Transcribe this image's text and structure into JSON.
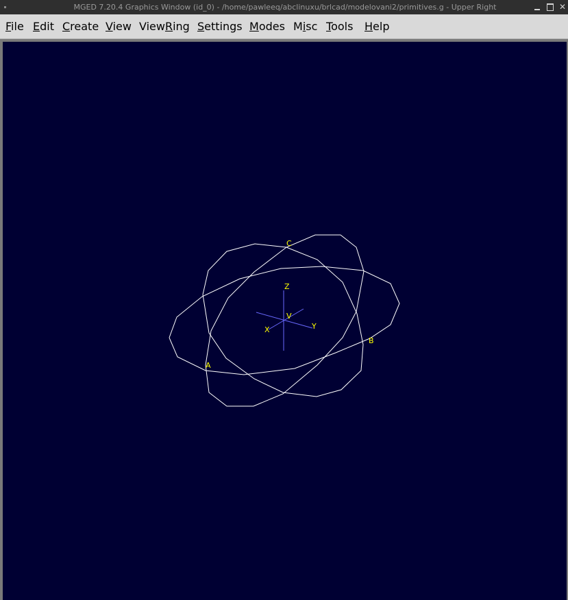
{
  "window": {
    "title": "MGED 7.20.4 Graphics Window (id_0) - /home/pawleeq/abclinuxu/brlcad/modelovani2/primitives.g - Upper Right"
  },
  "menu": {
    "items": [
      {
        "pre": "",
        "u": "F",
        "post": "ile"
      },
      {
        "pre": "",
        "u": "E",
        "post": "dit"
      },
      {
        "pre": "",
        "u": "C",
        "post": "reate"
      },
      {
        "pre": "",
        "u": "V",
        "post": "iew"
      },
      {
        "pre": "View",
        "u": "R",
        "post": "ing"
      },
      {
        "pre": "",
        "u": "S",
        "post": "ettings"
      },
      {
        "pre": "",
        "u": "M",
        "post": "odes"
      },
      {
        "pre": "M",
        "u": "i",
        "post": "sc"
      },
      {
        "pre": "",
        "u": "T",
        "post": "ools"
      },
      {
        "pre": "",
        "u": "H",
        "post": "elp"
      }
    ]
  },
  "viewport": {
    "labels": {
      "a": "A",
      "b": "B",
      "c": "C",
      "v": "V",
      "x": "X",
      "y": "Y",
      "z": "Z"
    },
    "colors": {
      "background": "#000033",
      "wireframe": "#ffffff",
      "labels": "#ffff00",
      "axes": "#6a6aff"
    }
  }
}
